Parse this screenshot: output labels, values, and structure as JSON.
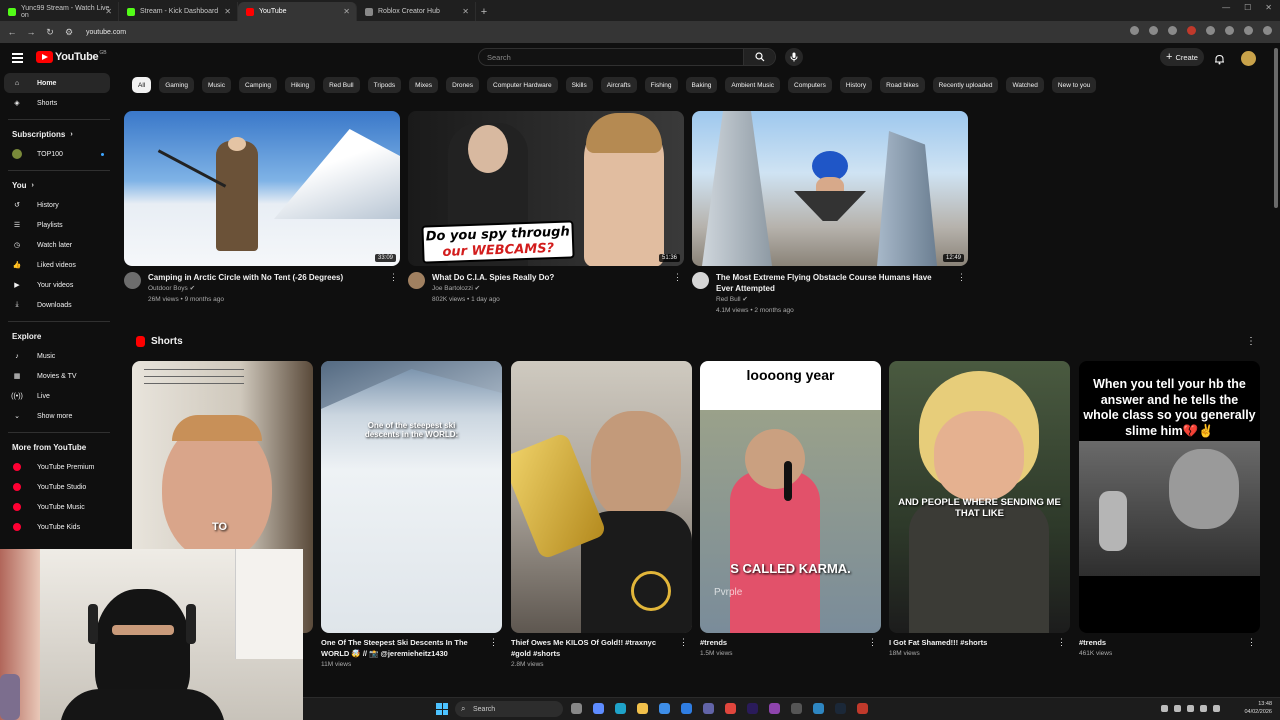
{
  "browser": {
    "tabs": [
      {
        "title": "Yunc99 Stream - Watch Live on",
        "color": "#53fc18"
      },
      {
        "title": "Stream - Kick Dashboard",
        "color": "#53fc18"
      },
      {
        "title": "YouTube",
        "color": "#ff0000"
      },
      {
        "title": "Roblox Creator Hub",
        "color": "#888888"
      }
    ],
    "url": "youtube.com"
  },
  "header": {
    "search_placeholder": "Search",
    "create_label": "Create",
    "logo_text": "YouTube",
    "logo_suffix": "GB"
  },
  "chips": [
    "All",
    "Gaming",
    "Music",
    "Camping",
    "Hiking",
    "Red Bull",
    "Tripods",
    "Mixes",
    "Drones",
    "Computer Hardware",
    "Skills",
    "Aircrafts",
    "Fishing",
    "Baking",
    "Ambient Music",
    "Computers",
    "History",
    "Road bikes",
    "Recently uploaded",
    "Watched",
    "New to you"
  ],
  "sidebar": {
    "main": [
      {
        "label": "Home",
        "icon": "home-icon"
      },
      {
        "label": "Shorts",
        "icon": "shorts-icon"
      }
    ],
    "subscriptions_header": "Subscriptions",
    "subscriptions": [
      {
        "label": "TOP100"
      }
    ],
    "you_header": "You",
    "you": [
      {
        "label": "History",
        "icon": "history-icon"
      },
      {
        "label": "Playlists",
        "icon": "playlists-icon"
      },
      {
        "label": "Watch later",
        "icon": "clock-icon"
      },
      {
        "label": "Liked videos",
        "icon": "thumbs-up-icon"
      },
      {
        "label": "Your videos",
        "icon": "video-icon"
      },
      {
        "label": "Downloads",
        "icon": "download-icon"
      }
    ],
    "explore_header": "Explore",
    "explore": [
      {
        "label": "Music",
        "icon": "music-icon"
      },
      {
        "label": "Movies & TV",
        "icon": "film-icon"
      },
      {
        "label": "Live",
        "icon": "live-icon"
      },
      {
        "label": "Show more",
        "icon": "chevron-down-icon"
      }
    ],
    "more_header": "More from YouTube",
    "more": [
      {
        "label": "YouTube Premium"
      },
      {
        "label": "YouTube Studio"
      },
      {
        "label": "YouTube Music"
      },
      {
        "label": "YouTube Kids"
      }
    ]
  },
  "videos": [
    {
      "title": "Camping in Arctic Circle with No Tent (-26 Degrees)",
      "channel": "Outdoor Boys",
      "stats": "26M views • 9 months ago",
      "duration": "33:09"
    },
    {
      "title": "What Do C.I.A. Spies Really Do?",
      "channel": "Joe Bartolozzi",
      "stats": "802K views • 1 day ago",
      "duration": "51:36",
      "overlay_line1": "Do you spy through",
      "overlay_line2": "our WEBCAMS?"
    },
    {
      "title": "The Most Extreme Flying Obstacle Course Humans Have Ever Attempted",
      "channel": "Red Bull",
      "stats": "4.1M views • 2 months ago",
      "duration": "12:49"
    }
  ],
  "shorts_section": {
    "title": "Shorts",
    "items": [
      {
        "title": "",
        "views": "",
        "overlay": "TO"
      },
      {
        "title": "One Of The Steepest Ski Descents In The WORLD 🤯 // 📸 @jeremieheitz1430",
        "views": "11M views",
        "overlay": "One of the steepest ski descents in the WORLD:"
      },
      {
        "title": "Thief Owes Me KILOS Of Gold!! #traxnyc #gold #shorts",
        "views": "2.8M views",
        "overlay": ""
      },
      {
        "title": "#trends",
        "views": "1.5M views",
        "overlay_top": "loooong year",
        "overlay": "S CALLED KARMA.",
        "overlay_small": "Pvrple"
      },
      {
        "title": "I Got Fat Shamed!!! #shorts",
        "views": "18M views",
        "overlay": "AND PEOPLE WHERE SENDING ME THAT LIKE"
      },
      {
        "title": "#trends",
        "views": "461K views",
        "overlay": "When you tell your hb the answer and he tells the whole class so you generally slime him💔✌️"
      }
    ]
  },
  "taskbar": {
    "search_label": "Search",
    "time": "13:48",
    "date": "04/02/2026"
  }
}
